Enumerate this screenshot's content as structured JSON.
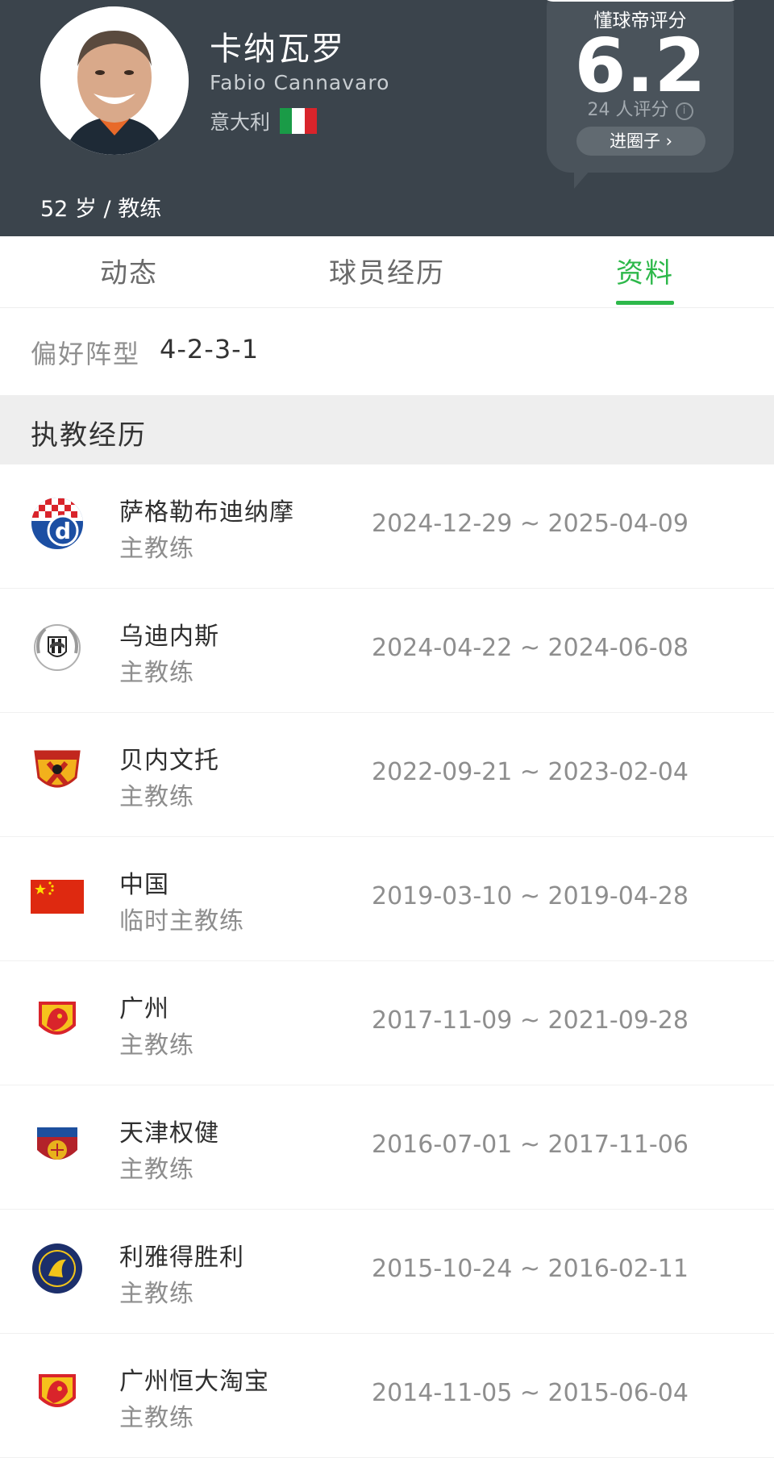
{
  "profile": {
    "name_cn": "卡纳瓦罗",
    "name_en": "Fabio Cannavaro",
    "country": "意大利",
    "age_role": "52 岁 / 教练"
  },
  "rating": {
    "title": "懂球帝评分",
    "score": "6.2",
    "count": "24 人评分",
    "info_icon": "i",
    "button": "进圈子 ›"
  },
  "tabs": [
    {
      "label": "动态",
      "active": false
    },
    {
      "label": "球员经历",
      "active": false
    },
    {
      "label": "资料",
      "active": true
    }
  ],
  "formation": {
    "label": "偏好阵型",
    "value": "4-2-3-1"
  },
  "section": {
    "title": "执教经历"
  },
  "career": [
    {
      "team": "萨格勒布迪纳摩",
      "role": "主教练",
      "dates": "2024-12-29 ~ 2025-04-09",
      "logo": "dinamo-zagreb-logo"
    },
    {
      "team": "乌迪内斯",
      "role": "主教练",
      "dates": "2024-04-22 ~ 2024-06-08",
      "logo": "udinese-logo"
    },
    {
      "team": "贝内文托",
      "role": "主教练",
      "dates": "2022-09-21 ~ 2023-02-04",
      "logo": "benevento-logo"
    },
    {
      "team": "中国",
      "role": "临时主教练",
      "dates": "2019-03-10 ~ 2019-04-28",
      "logo": "china-flag"
    },
    {
      "team": "广州",
      "role": "主教练",
      "dates": "2017-11-09 ~ 2021-09-28",
      "logo": "guangzhou-logo"
    },
    {
      "team": "天津权健",
      "role": "主教练",
      "dates": "2016-07-01 ~ 2017-11-06",
      "logo": "tianjin-quanjian-logo"
    },
    {
      "team": "利雅得胜利",
      "role": "主教练",
      "dates": "2015-10-24 ~ 2016-02-11",
      "logo": "al-nassr-logo"
    },
    {
      "team": "广州恒大淘宝",
      "role": "主教练",
      "dates": "2014-11-05 ~ 2015-06-04",
      "logo": "guangzhou-evergrande-logo"
    }
  ],
  "colors": {
    "header_bg": "#3b444c",
    "accent_green": "#2db84a",
    "section_bg": "#eeeeee"
  }
}
